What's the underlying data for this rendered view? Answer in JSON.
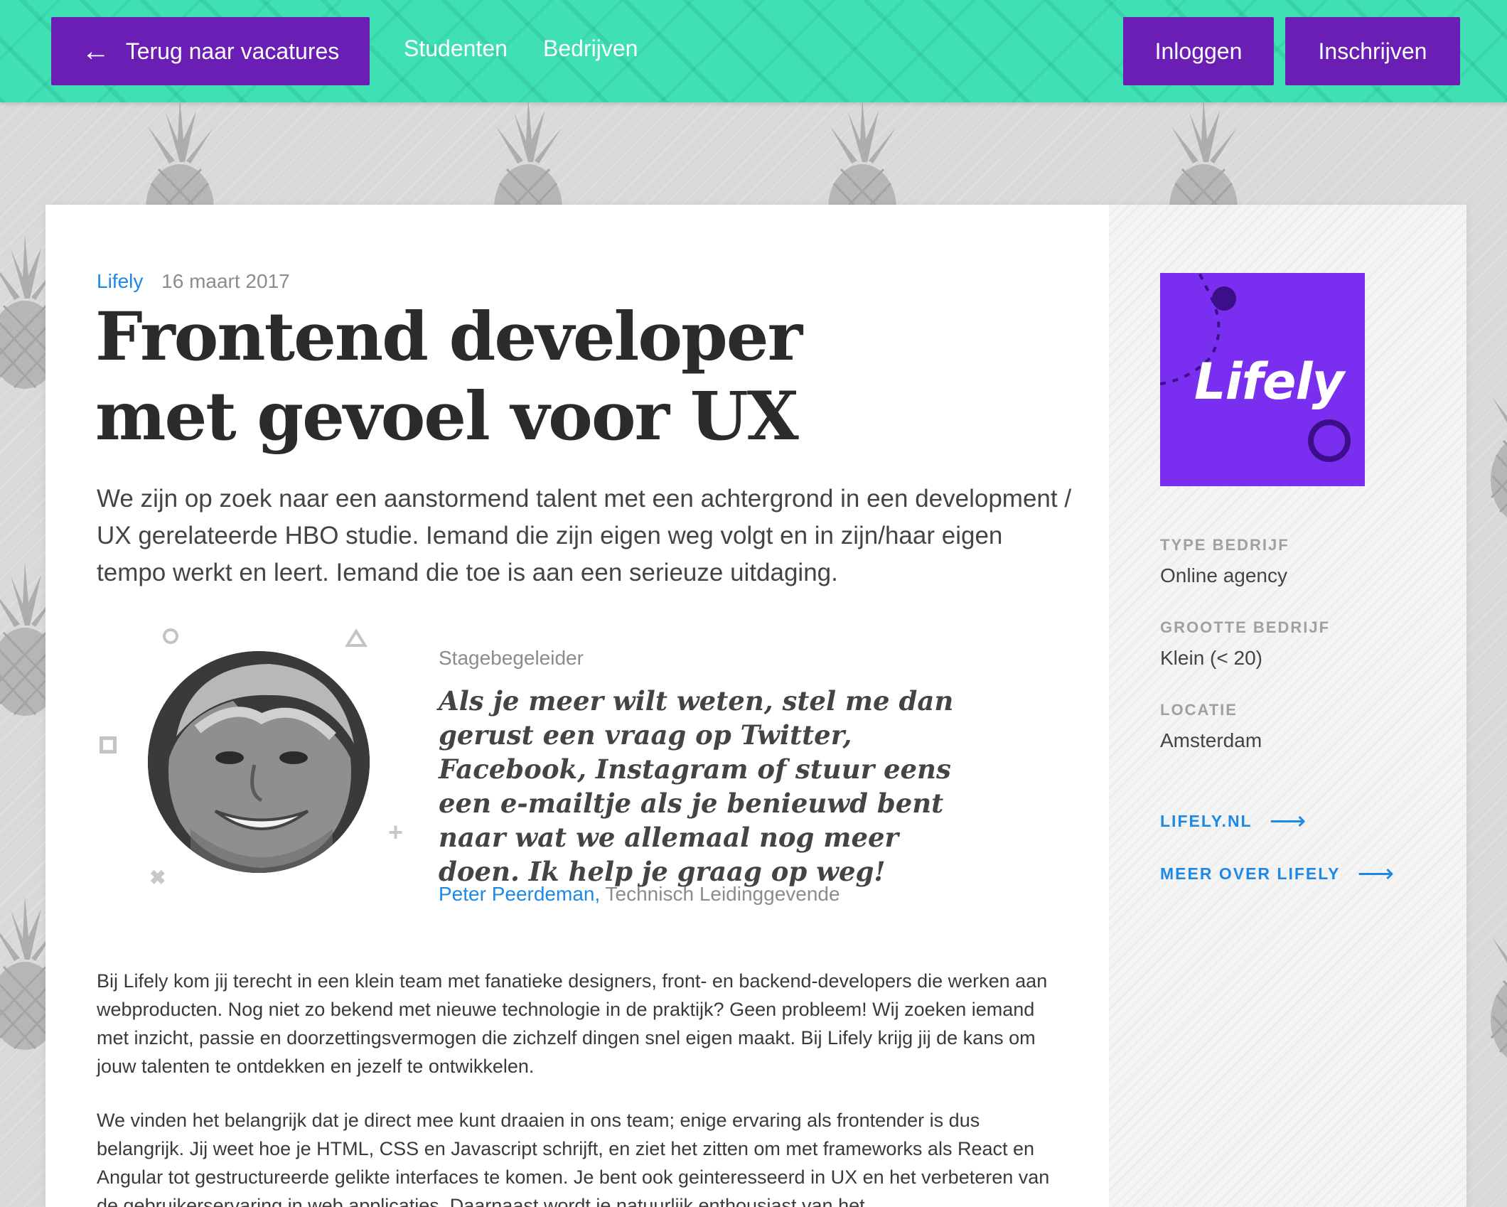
{
  "nav": {
    "back_label": "Terug naar vacatures",
    "back_icon": "arrow-left-icon",
    "students": "Studenten",
    "companies": "Bedrijven",
    "login": "Inloggen",
    "signup": "Inschrijven"
  },
  "article": {
    "company": "Lifely",
    "date": "16 maart 2017",
    "title": "Frontend developer met gevoel voor UX",
    "intro": "We zijn op zoek naar een aanstormend talent met een achtergrond in een development / UX gerelateerde HBO studie. Iemand die zijn eigen weg volgt en in zijn/haar eigen tempo werkt en leert. Iemand die toe is aan een serieuze uitdaging.",
    "quote": {
      "label": "Stagebegeleider",
      "text": "Als je meer wilt weten, stel me dan gerust een vraag op Twitter, Facebook, Instagram of stuur eens een e-mailtje als je benieuwd bent naar wat we allemaal nog meer doen. Ik help je graag op weg!",
      "author_name": "Peter Peerdeman,",
      "author_role": "Technisch Leidinggevende"
    },
    "paragraphs": [
      "Bij Lifely kom jij terecht in een klein team met fanatieke designers, front- en backend-developers die werken aan webproducten. Nog niet zo bekend met nieuwe technologie in de praktijk? Geen probleem! Wij zoeken iemand met inzicht, passie en doorzettingsvermogen die zichzelf dingen snel eigen maakt. Bij Lifely krijg jij de kans om jouw talenten te ontdekken en jezelf te ontwikkelen.",
      "We vinden het belangrijk dat je direct mee kunt draaien in ons team; enige ervaring als frontender is dus belangrijk. Jij weet hoe je HTML, CSS en Javascript schrijft, en ziet het zitten om met frameworks als React en Angular tot gestructureerde gelikte interfaces te komen. Je bent ook geinteresseerd in UX en het verbeteren van de gebruikerservaring in web applicaties. Daarnaast wordt je natuurlijk enthousiast van het"
    ]
  },
  "sidebar": {
    "logo_text": "Lifely",
    "type_label": "TYPE BEDRIJF",
    "type_value": "Online agency",
    "size_label": "GROOTTE BEDRIJF",
    "size_value": "Klein (< 20)",
    "location_label": "LOCATIE",
    "location_value": "Amsterdam",
    "link_website": "LIFELY.NL",
    "link_more": "MEER OVER LIFELY"
  },
  "colors": {
    "topbar": "#40e0b5",
    "button": "#6b1eb4",
    "link": "#1e88e5",
    "logo_bg": "#7a2ff0"
  }
}
